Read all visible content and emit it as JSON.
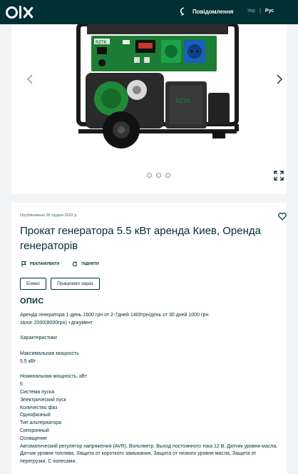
{
  "header": {
    "messages_label": "Повідомлення",
    "lang_uk": "Укр",
    "lang_separator": "|",
    "lang_ru": "Рус"
  },
  "gallery": {
    "photo_brand_label": "RZTK",
    "photo_count": 3,
    "active_photo": 1
  },
  "ad": {
    "published": "Опубліковано 05 грудня 2022 р.",
    "title": "Прокат генератора 5.5 кВт аренда Киев, Оренда генераторів",
    "advertise_label": "РЕКЛАМУВАТИ",
    "raise_label": "ПІДНЯТИ",
    "tags": [
      "Бізнес",
      "Працюємо зараз"
    ],
    "description_heading": "ОПИС",
    "description_lines": [
      "Аренда генератора 1-день 1600 грн от 2-7дней 1400грн/день от 30 дней 1000 грн",
      "залог 2000(8000грн) +документ",
      "",
      "Характеристики",
      "",
      "Максимальная мощность",
      "5.5 кВт",
      "",
      "Номинальная мощность, кВт",
      "5",
      "Система пуска",
      "Электрический пуск",
      "Количество фаз",
      "Однофазный",
      "Тип альтернатора",
      "Синхронный",
      "Оснащение",
      "Автоматический регулятор напряжения (AVR), Вольтметр, Выход постоянного тока 12 В, Датчик уровня масла, Датчик уровня топлива, Защита от короткого замыкания, Защита от низкого уровня масла, Защита от перегрузки, С колесами,"
    ]
  },
  "colors": {
    "brand_dark": "#002f34",
    "background": "#f2f4f5",
    "generator_green": "#2e8b3a"
  }
}
